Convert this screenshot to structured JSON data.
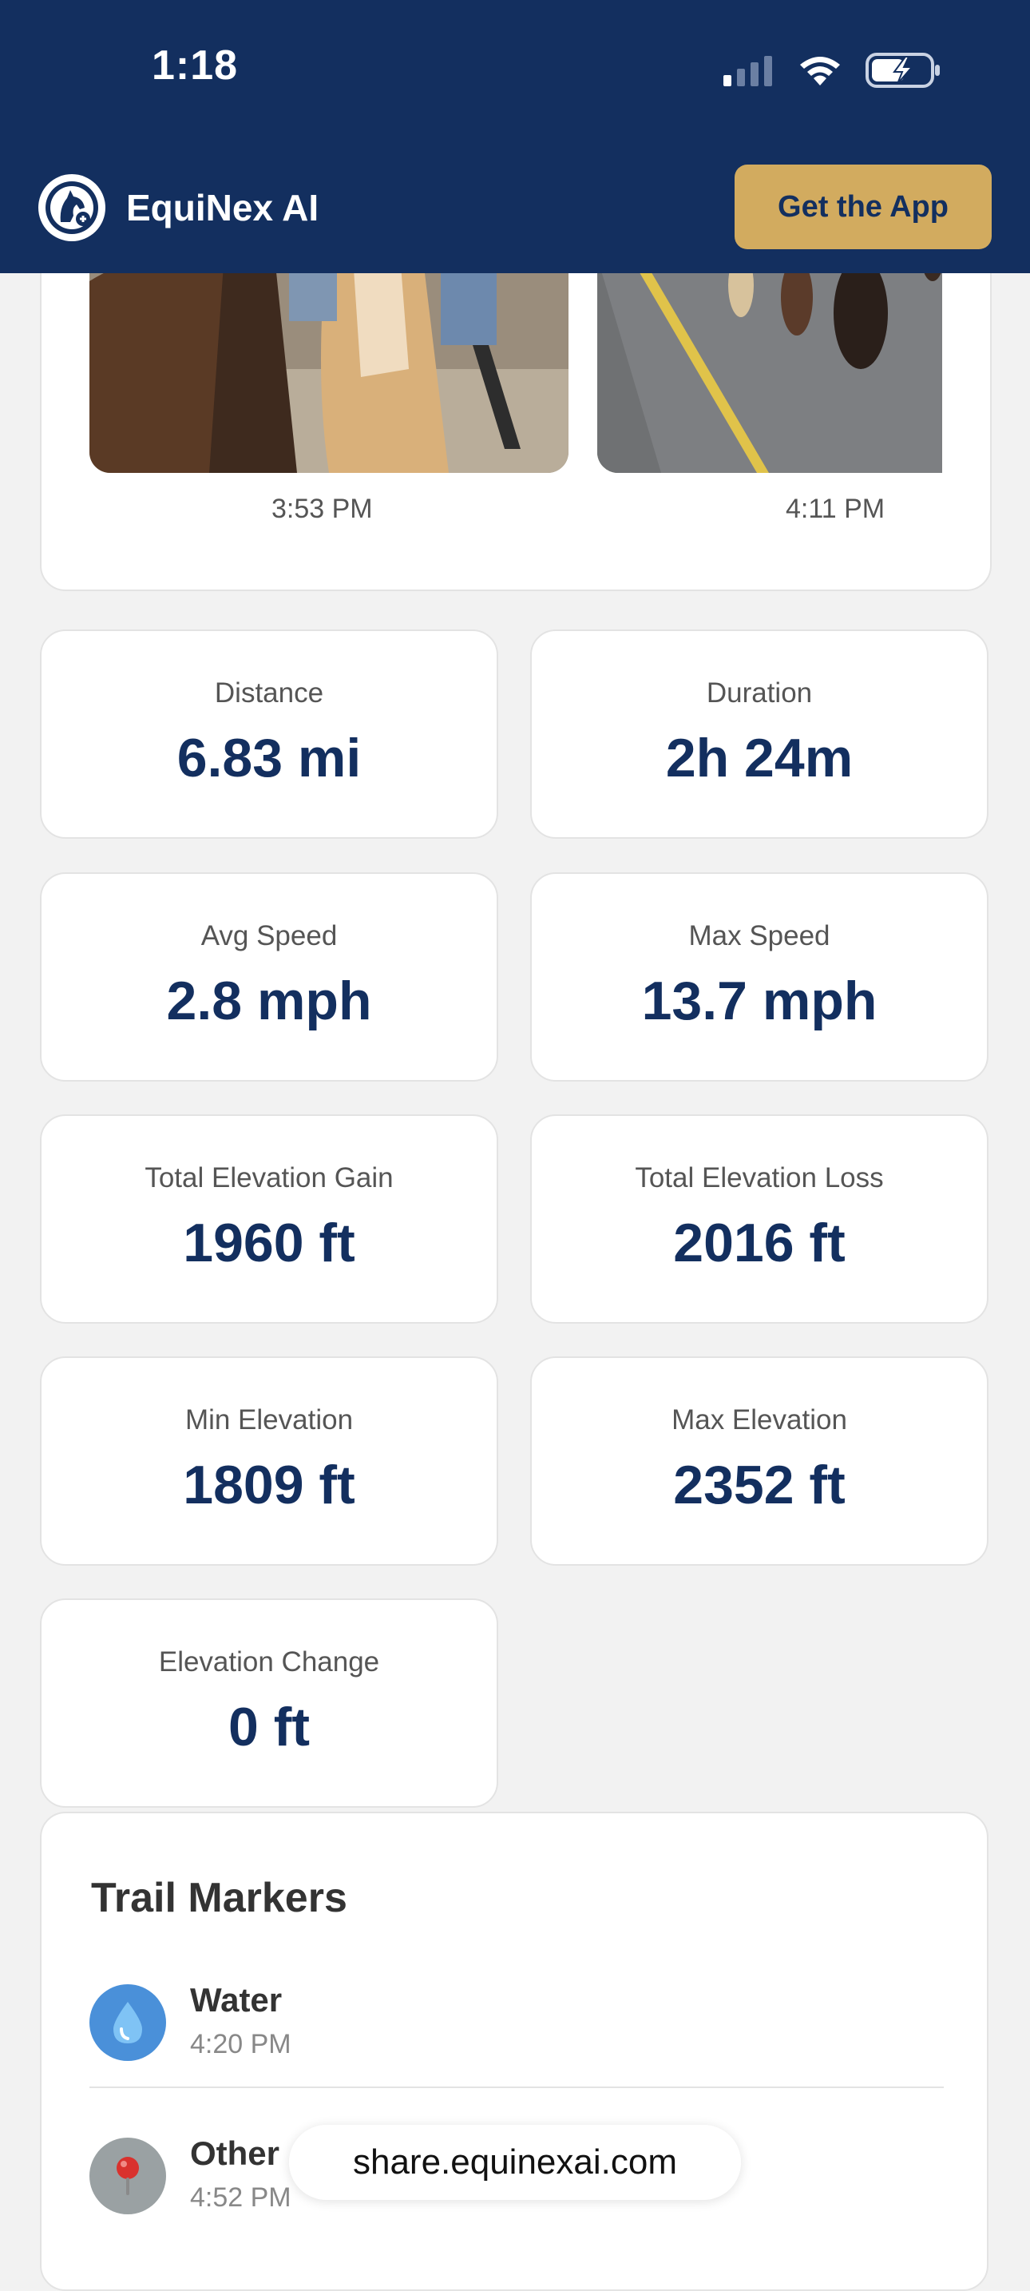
{
  "status_bar": {
    "time": "1:18"
  },
  "header": {
    "app_name": "EquiNex AI",
    "cta_label": "Get the App",
    "logo_icon": "horse-head-icon"
  },
  "photos": [
    {
      "time": "3:53 PM"
    },
    {
      "time": "4:11 PM"
    }
  ],
  "stats": [
    {
      "label": "Distance",
      "value": "6.83 mi"
    },
    {
      "label": "Duration",
      "value": "2h 24m"
    },
    {
      "label": "Avg Speed",
      "value": "2.8 mph"
    },
    {
      "label": "Max Speed",
      "value": "13.7 mph"
    },
    {
      "label": "Total Elevation Gain",
      "value": "1960 ft"
    },
    {
      "label": "Total Elevation Loss",
      "value": "2016 ft"
    },
    {
      "label": "Min Elevation",
      "value": "1809 ft"
    },
    {
      "label": "Max Elevation",
      "value": "2352 ft"
    },
    {
      "label": "Elevation Change",
      "value": "0 ft"
    }
  ],
  "trail_markers": {
    "title": "Trail Markers",
    "items": [
      {
        "name": "Water",
        "time": "4:20 PM",
        "icon": "water-drop-icon"
      },
      {
        "name": "Other",
        "time": "4:52 PM",
        "icon": "pin-icon"
      }
    ]
  },
  "browser": {
    "url": "share.equinexai.com"
  },
  "colors": {
    "header_bg": "#132f5f",
    "accent_gold": "#d2ab5f",
    "value_navy": "#132f5f",
    "water_blue": "#4a90d9",
    "pin_gray": "#9aa1a3"
  }
}
